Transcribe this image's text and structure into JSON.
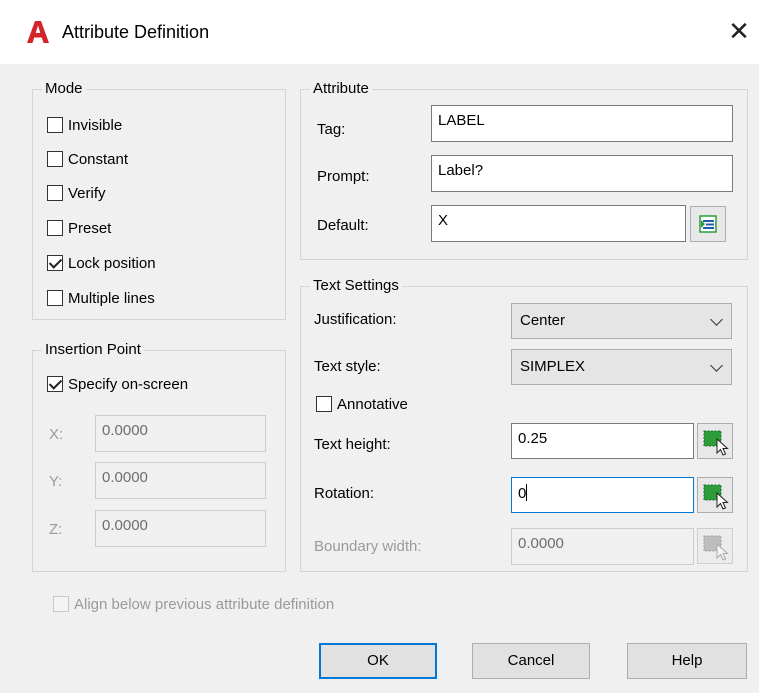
{
  "window": {
    "title": "Attribute Definition",
    "close_glyph": "✕"
  },
  "mode": {
    "legend": "Mode",
    "options": [
      {
        "label": "Invisible",
        "checked": false
      },
      {
        "label": "Constant",
        "checked": false
      },
      {
        "label": "Verify",
        "checked": false
      },
      {
        "label": "Preset",
        "checked": false
      },
      {
        "label": "Lock position",
        "checked": true
      },
      {
        "label": "Multiple lines",
        "checked": false
      }
    ]
  },
  "insertion_point": {
    "legend": "Insertion Point",
    "specify_on_screen": {
      "label": "Specify on-screen",
      "checked": true
    },
    "x": {
      "label": "X:",
      "value": "0.0000"
    },
    "y": {
      "label": "Y:",
      "value": "0.0000"
    },
    "z": {
      "label": "Z:",
      "value": "0.0000"
    }
  },
  "attribute": {
    "legend": "Attribute",
    "tag": {
      "label": "Tag:",
      "value": "LABEL"
    },
    "prompt": {
      "label": "Prompt:",
      "value": "Label?"
    },
    "default": {
      "label": "Default:",
      "value": "X"
    }
  },
  "text_settings": {
    "legend": "Text Settings",
    "justification": {
      "label": "Justification:",
      "value": "Center"
    },
    "text_style": {
      "label": "Text style:",
      "value": "SIMPLEX"
    },
    "annotative": {
      "label": "Annotative",
      "checked": false
    },
    "text_height": {
      "label": "Text height:",
      "value": "0.25"
    },
    "rotation": {
      "label": "Rotation:",
      "value": "0"
    },
    "boundary_width": {
      "label": "Boundary width:",
      "value": "0.0000"
    }
  },
  "align_below": {
    "label": "Align below previous attribute definition",
    "checked": false
  },
  "buttons": {
    "ok": "OK",
    "cancel": "Cancel",
    "help": "Help"
  },
  "colors": {
    "accent": "#0078d7",
    "app_icon": "#d5232a",
    "field_pick_green": "#2e9c3a"
  },
  "icons": {
    "app": "autocad-a-icon",
    "insert_field": "insert-field-icon",
    "pick_point": "pick-point-icon"
  }
}
